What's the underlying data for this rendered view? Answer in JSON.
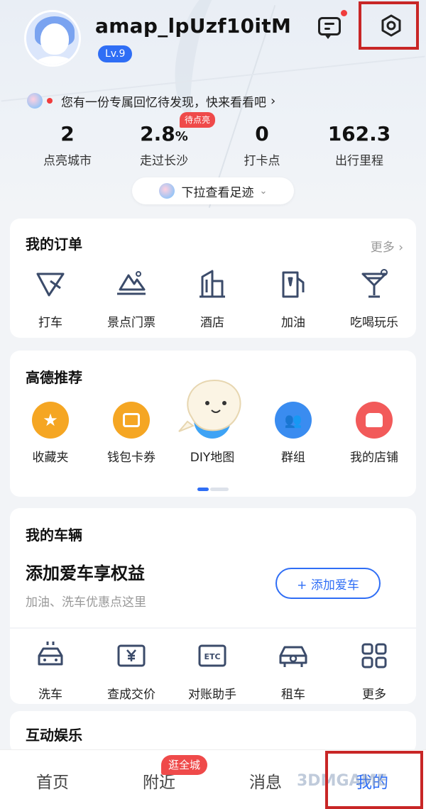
{
  "header": {
    "username": "amap_lpUzf10itM",
    "level": "Lv.9",
    "memory_text": "您有一份专属回忆待发现，快来看看吧",
    "memory_arrow": "›",
    "pending_badge": "待点亮",
    "pull_text": "下拉查看足迹",
    "pull_chevron": "⌄"
  },
  "stats": [
    {
      "value": "2",
      "unit": "",
      "label": "点亮城市"
    },
    {
      "value": "2.8",
      "unit": "%",
      "label": "走过长沙"
    },
    {
      "value": "0",
      "unit": "",
      "label": "打卡点"
    },
    {
      "value": "162.3",
      "unit": "",
      "label": "出行里程"
    }
  ],
  "orders": {
    "title": "我的订单",
    "more": "更多 ›",
    "items": [
      {
        "label": "打车",
        "icon": "taxi-icon"
      },
      {
        "label": "景点门票",
        "icon": "scenic-ticket-icon"
      },
      {
        "label": "酒店",
        "icon": "hotel-icon"
      },
      {
        "label": "加油",
        "icon": "fuel-icon"
      },
      {
        "label": "吃喝玩乐",
        "icon": "cocktail-icon"
      }
    ]
  },
  "recommend": {
    "title": "高德推荐",
    "items": [
      {
        "label": "收藏夹",
        "icon": "star-icon",
        "color": "#f5a623"
      },
      {
        "label": "钱包卡券",
        "icon": "wallet-icon",
        "color": "#f5a623"
      },
      {
        "label": "DIY地图",
        "icon": "diy-map-icon",
        "color": "#3ea3f5"
      },
      {
        "label": "群组",
        "icon": "group-icon",
        "color": "#3a8cf0"
      },
      {
        "label": "我的店铺",
        "icon": "shop-icon",
        "color": "#f25a5a"
      }
    ]
  },
  "vehicle": {
    "title": "我的车辆",
    "headline": "添加爱车享权益",
    "subtitle": "加油、洗车优惠点这里",
    "add_button": "+ 添加爱车",
    "items": [
      {
        "label": "洗车",
        "icon": "car-wash-icon"
      },
      {
        "label": "查成交价",
        "icon": "price-icon"
      },
      {
        "label": "对账助手",
        "icon": "etc-icon"
      },
      {
        "label": "租车",
        "icon": "rent-car-icon"
      },
      {
        "label": "更多",
        "icon": "grid-icon"
      }
    ]
  },
  "entertainment": {
    "title": "互动娱乐"
  },
  "tabbar": {
    "items": [
      "首页",
      "附近",
      "消息",
      "我的"
    ],
    "nearby_badge": "逛全城",
    "watermark": "3DMGAME",
    "active_color": "#2f6ef5"
  }
}
